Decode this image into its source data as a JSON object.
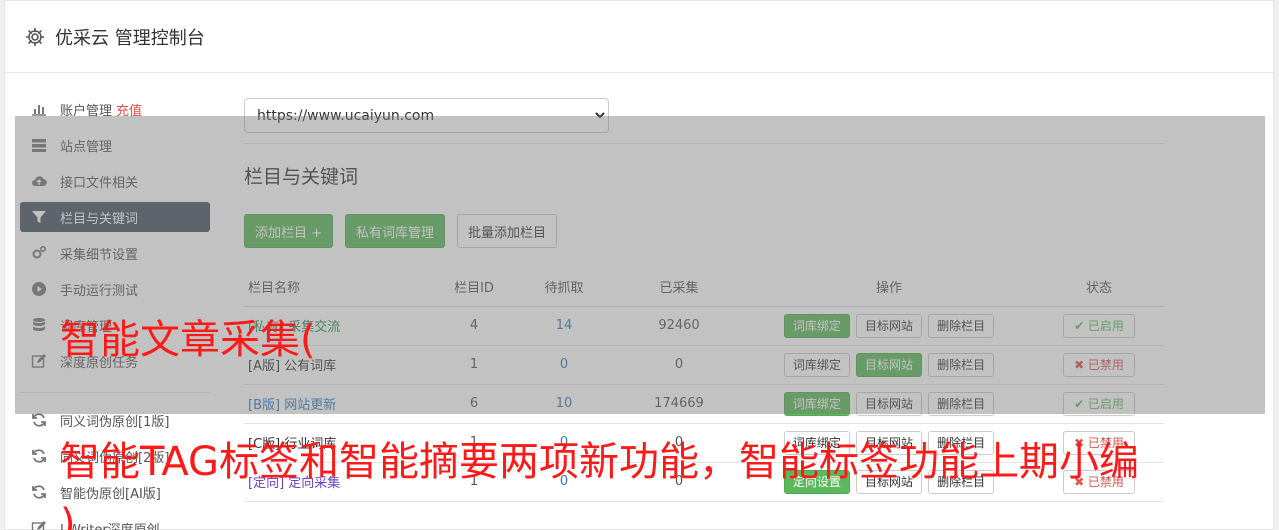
{
  "header": {
    "title": "优采云 管理控制台"
  },
  "sidebar": {
    "items": [
      {
        "label": "账户管理",
        "extra": "充值",
        "icon": "bar-chart-icon"
      },
      {
        "label": "站点管理",
        "icon": "server-icon"
      },
      {
        "label": "接口文件相关",
        "icon": "cloud-upload-icon"
      },
      {
        "label": "栏目与关键词",
        "icon": "filter-icon",
        "active": true
      },
      {
        "label": "采集细节设置",
        "icon": "gears-icon"
      },
      {
        "label": "手动运行测试",
        "icon": "play-circle-icon"
      },
      {
        "label": "词库管理",
        "icon": "database-icon"
      },
      {
        "label": "深度原创任务",
        "icon": "edit-icon"
      }
    ],
    "items2": [
      {
        "label": "同义词伪原创[1版]",
        "icon": "refresh-icon"
      },
      {
        "label": "同义词伪原创[2版]",
        "icon": "refresh-icon"
      },
      {
        "label": "智能伪原创[AI版]",
        "icon": "refresh-icon"
      },
      {
        "label": "I-Writer深度原创",
        "icon": "edit-icon"
      }
    ]
  },
  "main": {
    "site_select": {
      "value": "https://www.ucaiyun.com",
      "options": [
        "https://www.ucaiyun.com"
      ]
    },
    "section_title": "栏目与关键词",
    "buttons": {
      "add_column": "添加栏目 +",
      "private_lib": "私有词库管理",
      "batch_add": "批量添加栏目"
    },
    "table": {
      "headers": [
        "栏目名称",
        "栏目ID",
        "待抓取",
        "已采集",
        "操作",
        "状态"
      ],
      "action_labels": {
        "bind": "词库绑定",
        "target": "目标网站",
        "delete": "删除栏目",
        "directed": "定向设置"
      },
      "rows": [
        {
          "name": "[私有] 采集交流",
          "id": "4",
          "pending": "14",
          "collected": "92460",
          "status": "✔ 已启用"
        },
        {
          "name": "[A版] 公有词库",
          "id": "1",
          "pending": "0",
          "collected": "0",
          "status": "✖ 已禁用"
        },
        {
          "name": "[B版] 网站更新",
          "id": "6",
          "pending": "10",
          "collected": "174669",
          "status": "✔ 已启用"
        },
        {
          "name": "[C版] 行业词库",
          "id": "1",
          "pending": "0",
          "collected": "0",
          "status": "✖ 已禁用"
        },
        {
          "name": "[定向] 定向采集",
          "id": "1",
          "pending": "0",
          "collected": "0",
          "status": "✖ 已禁用"
        }
      ]
    }
  },
  "watermark": {
    "line1": "智能文章采集(",
    "line2": "智能TAG标签和智能摘要两项新功能，智能标签功能上期小编",
    "line3": ")"
  },
  "colors": {
    "green": "#5cb85c",
    "active_nav": "#4a5561",
    "red": "#d9534f",
    "watermark": "#ff1a1a"
  }
}
